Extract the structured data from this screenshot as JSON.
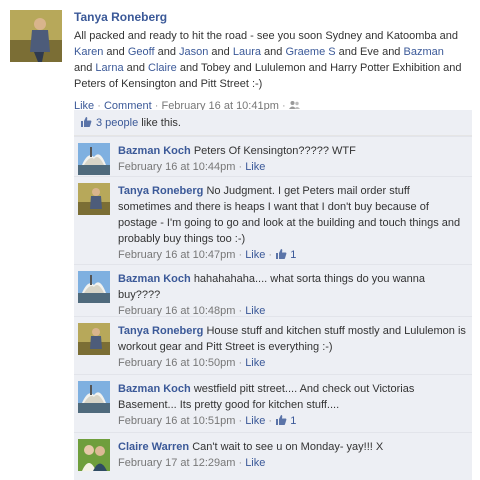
{
  "post": {
    "author": "Tanya Roneberg",
    "text_parts": [
      {
        "t": "All packed and ready to hit the road - see you soon Sydney and Katoomba and ",
        "link": false
      },
      {
        "t": "Karen",
        "link": true
      },
      {
        "t": " and ",
        "link": false
      },
      {
        "t": "Geoff",
        "link": true
      },
      {
        "t": " and ",
        "link": false
      },
      {
        "t": "Jason",
        "link": true
      },
      {
        "t": " and ",
        "link": false
      },
      {
        "t": "Laura",
        "link": true
      },
      {
        "t": " and ",
        "link": false
      },
      {
        "t": "Graeme S",
        "link": true
      },
      {
        "t": " and Eve and ",
        "link": false
      },
      {
        "t": "Bazman",
        "link": true
      },
      {
        "t": " and ",
        "link": false
      },
      {
        "t": "Larna",
        "link": true
      },
      {
        "t": " and ",
        "link": false
      },
      {
        "t": "Claire",
        "link": true
      },
      {
        "t": " and Tobey and Lululemon and Harry Potter Exhibition and Peters of Kensington and Pitt Street :-)",
        "link": false
      }
    ],
    "like_label": "Like",
    "comment_label": "Comment",
    "timestamp": "February 16 at 10:41pm"
  },
  "likes_summary": {
    "count_text": "3 people",
    "suffix": "like this."
  },
  "comments": [
    {
      "author": "Bazman Koch",
      "avatar": "bazman",
      "text": "Peters Of Kensington????? WTF",
      "timestamp": "February 16 at 10:44pm",
      "like_label": "Like",
      "likes": ""
    },
    {
      "author": "Tanya Roneberg",
      "avatar": "tanya",
      "text": "No Judgment. I get Peters mail order stuff sometimes and there is heaps I want that I don't buy because of postage - I'm going to go and look at the building and touch things and probably buy things too :-)",
      "timestamp": "February 16 at 10:47pm",
      "like_label": "Like",
      "likes": "1"
    },
    {
      "author": "Bazman Koch",
      "avatar": "bazman",
      "text": "hahahahaha.... what sorta things do you wanna buy????",
      "timestamp": "February 16 at 10:48pm",
      "like_label": "Like",
      "likes": ""
    },
    {
      "author": "Tanya Roneberg",
      "avatar": "tanya",
      "text": "House stuff and kitchen stuff mostly and Lululemon is workout gear and Pitt Street is everything :-)",
      "timestamp": "February 16 at 10:50pm",
      "like_label": "Like",
      "likes": ""
    },
    {
      "author": "Bazman Koch",
      "avatar": "bazman",
      "text": "westfield pitt street.... And check out Victorias Basement... Its pretty good for kitchen stuff....",
      "timestamp": "February 16 at 10:51pm",
      "like_label": "Like",
      "likes": "1"
    },
    {
      "author": "Claire Warren",
      "avatar": "claire",
      "text": "Can't wait to see u on Monday- yay!!! X",
      "timestamp": "February 17 at 12:29am",
      "like_label": "Like",
      "likes": ""
    }
  ],
  "icons": {
    "privacy": "friends-privacy-icon",
    "like_thumb": "thumbs-up-icon"
  },
  "colors": {
    "link": "#3b5998",
    "feedback_bg": "#edeff4",
    "meta": "#777777"
  }
}
